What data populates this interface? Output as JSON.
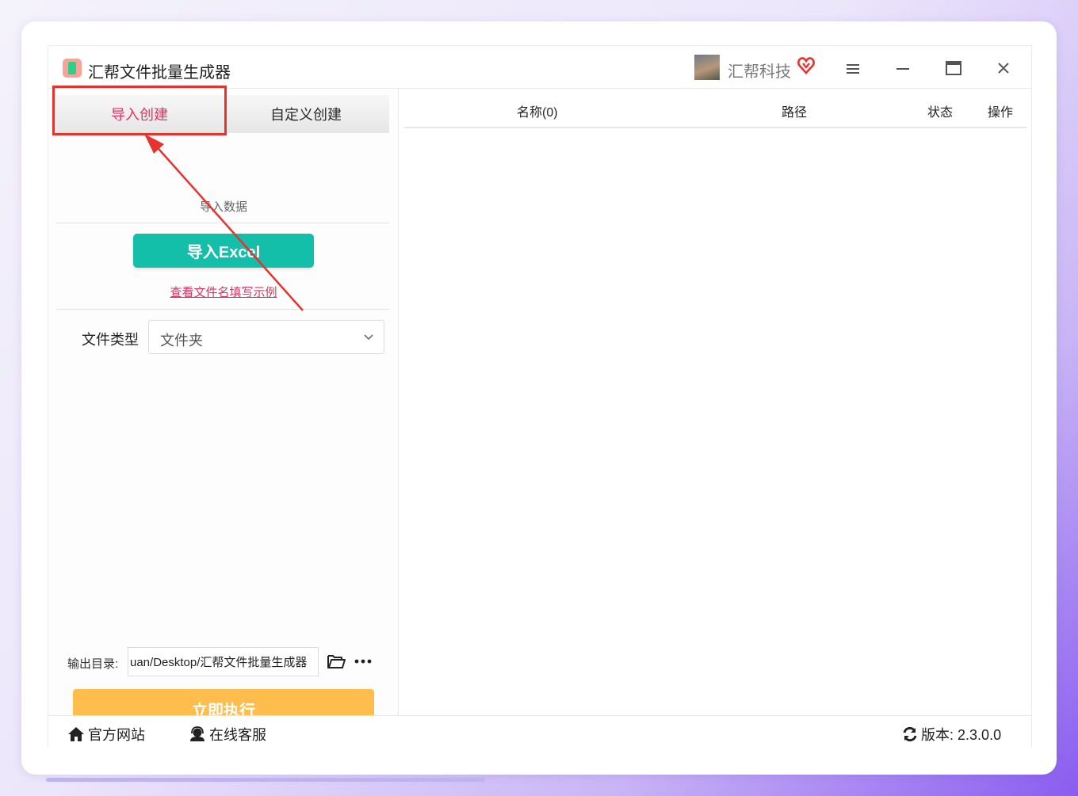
{
  "app": {
    "title": "汇帮文件批量生成器",
    "company": "汇帮科技"
  },
  "tabs": {
    "import": "导入创建",
    "custom": "自定义创建"
  },
  "left": {
    "section_label": "导入数据",
    "import_button": "导入Excel",
    "example_link": "查看文件名填写示例",
    "file_type_label": "文件类型",
    "file_type_value": "文件夹",
    "output_label": "输出目录:",
    "output_value": "uan/Desktop/汇帮文件批量生成器",
    "run_button": "立即执行"
  },
  "table": {
    "columns": [
      "名称(0)",
      "路径",
      "状态",
      "操作"
    ]
  },
  "footer": {
    "website": "官方网站",
    "service": "在线客服",
    "version_label": "版本:",
    "version_value": "2.3.0.0"
  },
  "colors": {
    "accent_red": "#e0335e",
    "excel_button": "#13bfa8",
    "run_button": "#ffbd4d",
    "annotation": "#e8322e"
  }
}
